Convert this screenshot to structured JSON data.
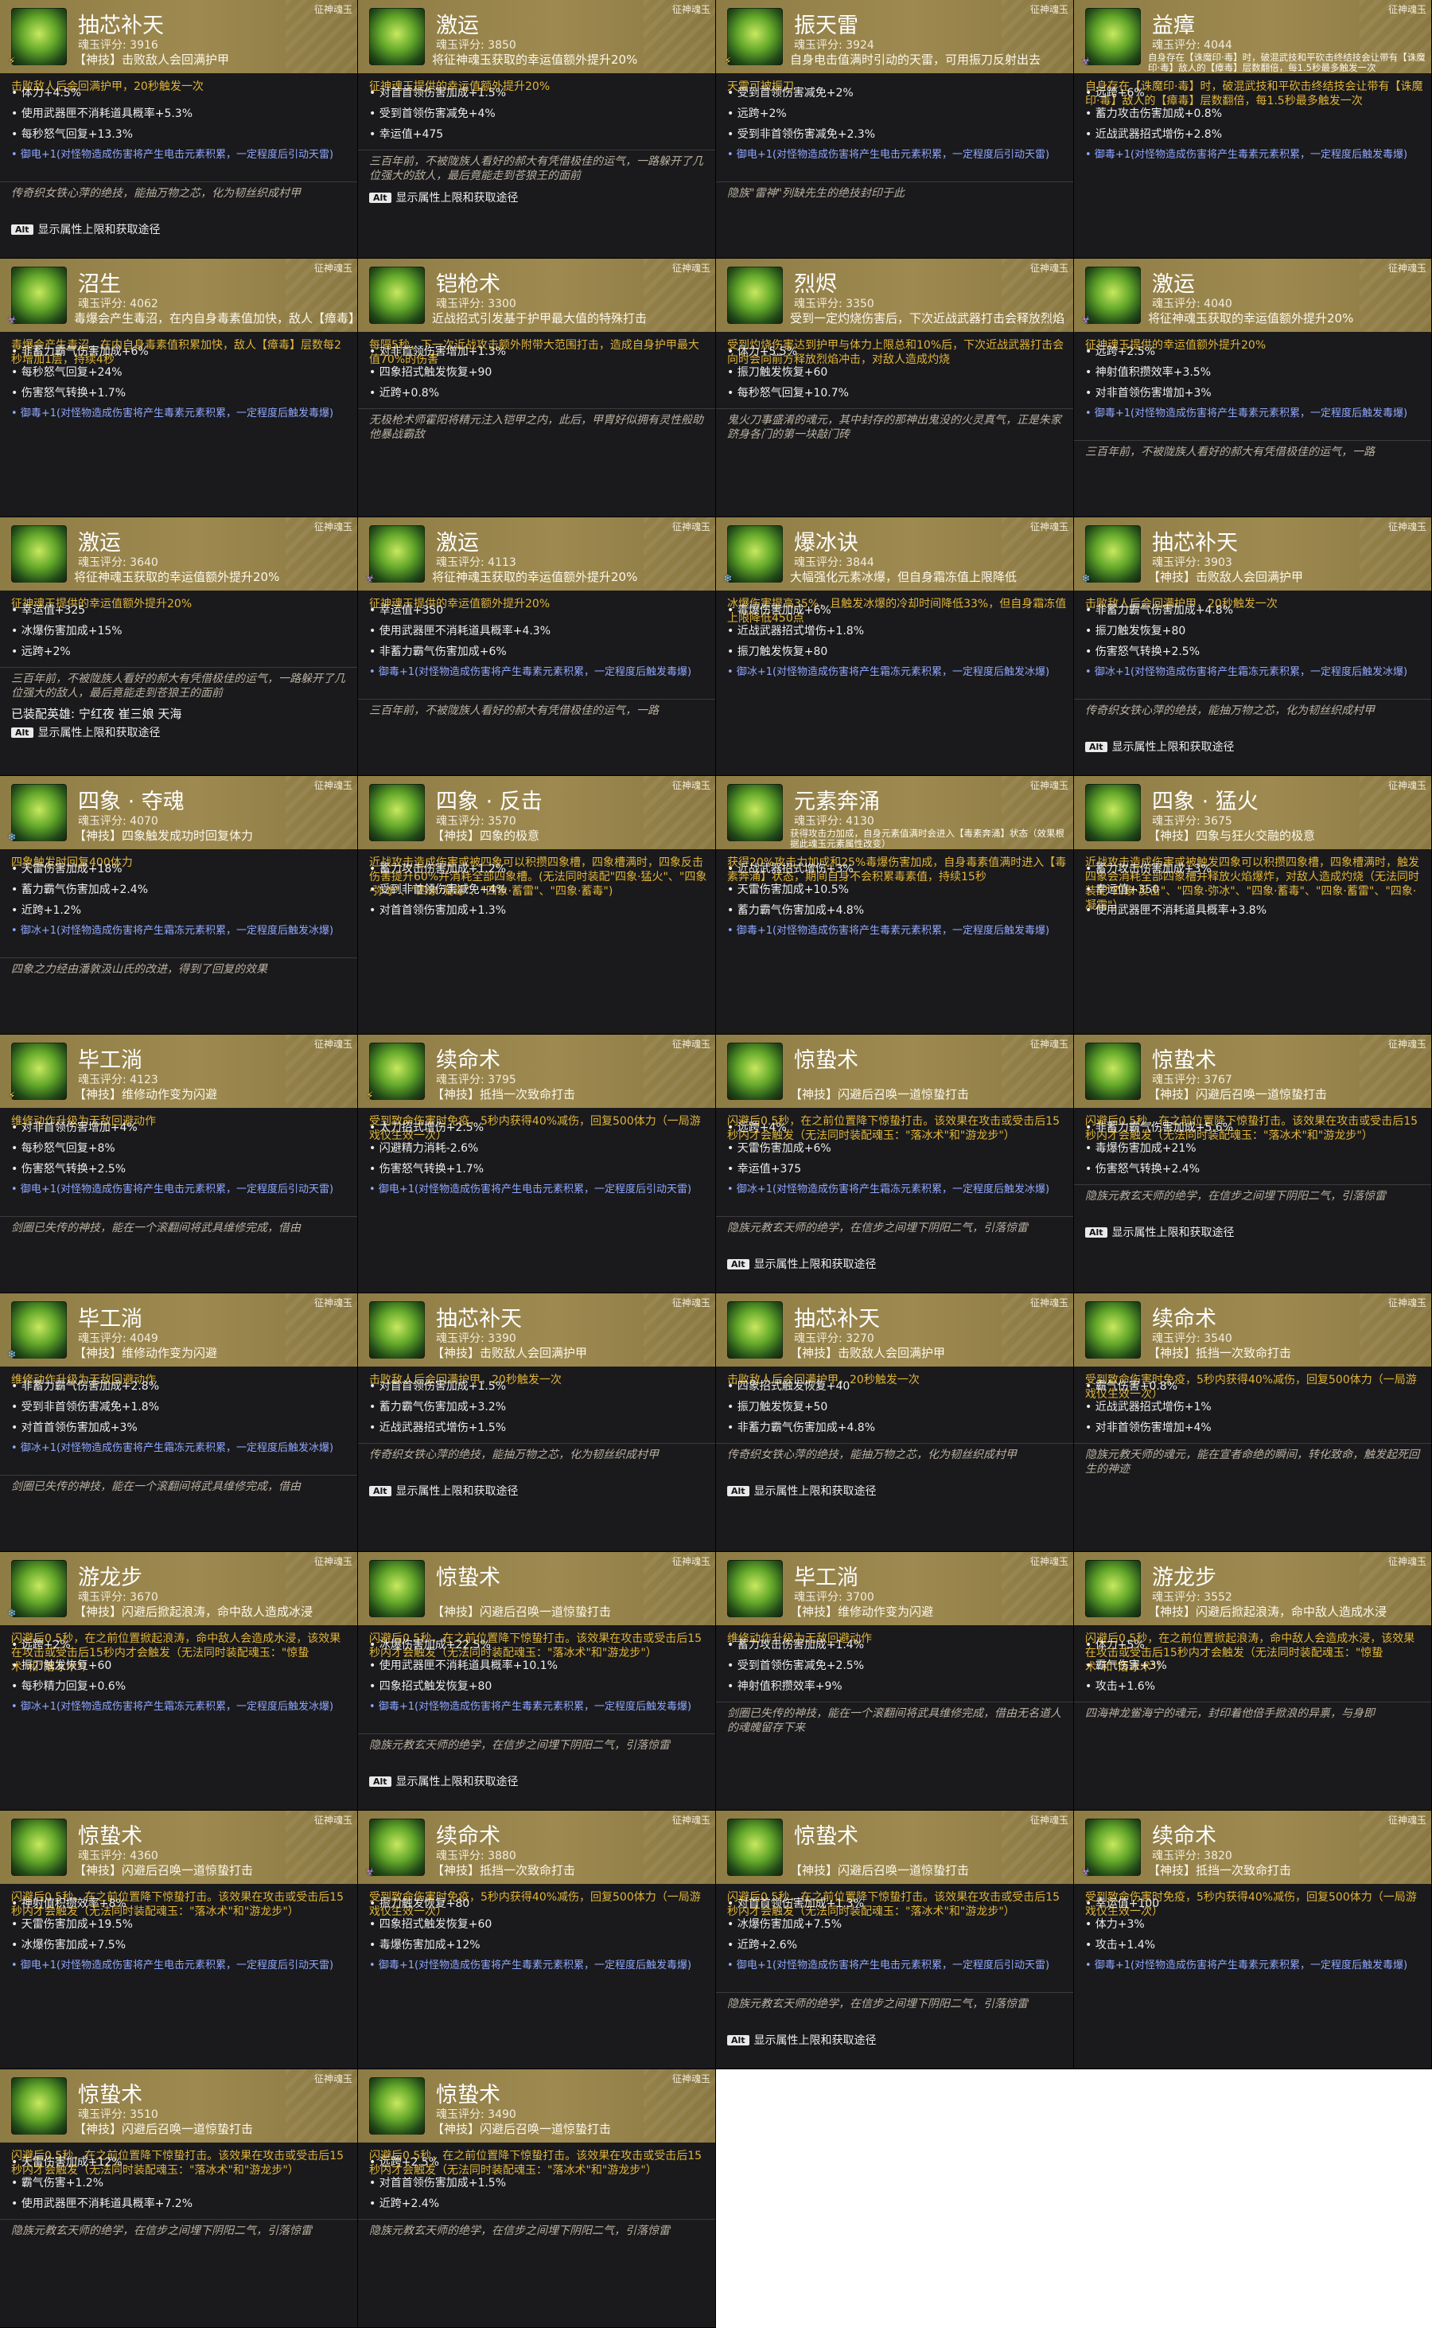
{
  "cards": [
    {
      "type": "征神魂玉",
      "name": "抽芯补天",
      "score": "魂玉评分: 3916",
      "desc": "【神技】击败敌人会回满护甲",
      "element": "thunder",
      "effect": "击败敌人后会回满护甲，20秒触发一次",
      "stats": [
        "体力+4.5%",
        "使用武器匣不消耗道具概率+5.3%",
        "每秒怒气回复+13.3%"
      ],
      "set": "御电+1(对怪物造成伤害将产生电击元素积累，一定程度后引动天雷)",
      "lore": "传奇织女铁心萍的绝技，能抽万物之芯，化为韧丝织成村甲",
      "footer": "显示属性上限和获取途径"
    },
    {
      "type": "征神魂玉",
      "name": "激运",
      "score": "魂玉评分: 3850",
      "desc": "将征神魂玉获取的幸运值额外提升20%",
      "element": "",
      "effect": "征神魂玉提供的幸运值额外提升20%",
      "stats": [
        "对首首领伤害加成+1.5%",
        "受到首领伤害减免+4%",
        "幸运值+475"
      ],
      "set": "",
      "lore": "三百年前，不被陇族人看好的郝大有凭借极佳的运气，一路躲开了几位强大的敌人，最后竟能走到苍狼王的面前",
      "footer": "显示属性上限和获取途径"
    },
    {
      "type": "征神魂玉",
      "name": "振天雷",
      "score": "魂玉评分: 3924",
      "desc": "自身电击值满时引动的天雷，可用振刀反射出去",
      "element": "thunder",
      "effect": "天雷可被振刀",
      "stats": [
        "受到首领伤害减免+2%",
        "远跨+2%",
        "受到非首领伤害减免+2.3%"
      ],
      "set": "御电+1(对怪物造成伤害将产生电击元素积累，一定程度后引动天雷)",
      "lore": "隐族\"雷神\"列缺先生的绝技封印于此",
      "footer": ""
    },
    {
      "type": "征神魂玉",
      "name": "益瘴",
      "score": "魂玉评分: 4044",
      "desc": "自身存在【诛魔印·毒】时，破混武技和平砍击终结技会让带有【诛魔印·毒】敌人的【瘴毒】层数翻倍，每1.5秒最多触发一次",
      "descSmall": true,
      "element": "poison",
      "effect": "自身存在【诛魔印·毒】时，破混武技和平砍击终结技会让带有【诛魔印·毒】敌人的【瘴毒】层数翻倍，每1.5秒最多触发一次",
      "stats": [
        "远跨+6%",
        "蓄力攻击伤害加成+0.8%",
        "近战武器招式增伤+2.8%"
      ],
      "set": "御毒+1(对怪物造成伤害将产生毒素元素积累，一定程度后触发毒爆)",
      "lore": "",
      "footer": ""
    },
    {
      "type": "征神魂玉",
      "name": "沼生",
      "score": "魂玉评分: 4062",
      "desc": "毒爆会产生毒沼，在内自身毒素值加快，敌人【瘴毒】层数",
      "element": "poison",
      "effect": "毒爆会产生毒沼，在内自身毒素值积累加快，敌人【瘴毒】层数每2秒增加1层，持续4秒",
      "stats": [
        "非蓄力霸气伤害加成+6%",
        "每秒怒气回复+24%",
        "伤害怒气转换+1.7%"
      ],
      "set": "御毒+1(对怪物造成伤害将产生毒素元素积累，一定程度后触发毒爆)",
      "lore": "",
      "footer": ""
    },
    {
      "type": "征神魂玉",
      "name": "铠枪术",
      "score": "魂玉评分: 3300",
      "desc": "近战招式引发基于护甲最大值的特殊打击",
      "element": "",
      "effect": "每隔5秒，下一次近战攻击额外附带大范围打击，造成自身护甲最大值70%的伤害",
      "stats": [
        "对非首领伤害增加+1.3%",
        "四象招式触发恢复+90",
        "近跨+0.8%"
      ],
      "set": "",
      "lore": "无极枪术师霍阳将精元注入铠甲之内，此后，甲胄好似拥有灵性般助他暴战霸敌",
      "footer": ""
    },
    {
      "type": "征神魂玉",
      "name": "烈烬",
      "score": "魂玉评分: 3350",
      "desc": "受到一定灼烧伤害后，下次近战武器打击会释放烈焰",
      "element": "",
      "effect": "受到灼烧伤害达到护甲与体力上限总和10%后，下次近战武器打击会向时会向前方释放烈焰冲击，对敌人造成灼烧",
      "stats": [
        "体力+5.5%",
        "振刀触发恢复+60",
        "每秒怒气回复+10.7%"
      ],
      "set": "",
      "lore": "鬼火刀事盛淆的魂元，其中封存的那神出鬼没的火灵真气，正是朱家跻身各门的第一块敲门砖",
      "footer": ""
    },
    {
      "type": "征神魂玉",
      "name": "激运",
      "score": "魂玉评分: 4040",
      "desc": "将征神魂玉获取的幸运值额外提升20%",
      "element": "poison",
      "effect": "征神魂玉提供的幸运值额外提升20%",
      "stats": [
        "远跨+2.5%",
        "神射值积攒效率+3.5%",
        "对非首领伤害增加+3%"
      ],
      "set": "御毒+1(对怪物造成伤害将产生毒素元素积累，一定程度后触发毒爆)",
      "lore": "三百年前，不被陇族人看好的郝大有凭借极佳的运气，一路",
      "footer": ""
    },
    {
      "type": "征神魂玉",
      "name": "激运",
      "score": "魂玉评分: 3640",
      "desc": "将征神魂玉获取的幸运值额外提升20%",
      "element": "",
      "effect": "征神魂玉提供的幸运值额外提升20%",
      "stats": [
        "幸运值+325",
        "冰爆伤害加成+15%",
        "远跨+2%"
      ],
      "set": "",
      "lore": "三百年前，不被陇族人看好的郝大有凭借极佳的运气，一路躲开了几位强大的敌人，最后竟能走到苍狼王的面前",
      "footer": "显示属性上限和获取途径",
      "equip": "已装配英雄: 宁红夜 崔三娘 天海"
    },
    {
      "type": "征神魂玉",
      "name": "激运",
      "score": "魂玉评分: 4113",
      "desc": "将征神魂玉获取的幸运值额外提升20%",
      "element": "poison",
      "effect": "征神魂玉提供的幸运值额外提升20%",
      "stats": [
        "幸运值+350",
        "使用武器匣不消耗道具概率+4.3%",
        "非蓄力霸气伤害加成+6%"
      ],
      "set": "御毒+1(对怪物造成伤害将产生毒素元素积累，一定程度后触发毒爆)",
      "lore": "三百年前，不被陇族人看好的郝大有凭借极佳的运气，一路",
      "footer": ""
    },
    {
      "type": "征神魂玉",
      "name": "爆冰诀",
      "score": "魂玉评分: 3844",
      "desc": "大幅强化元素冰爆，但自身霜冻值上限降低",
      "element": "ice",
      "effect": "冰爆伤害提高35%，且触发冰爆的冷却时间降低33%，但自身霜冻值上限降低450点",
      "stats": [
        "毒爆伤害加成+6%",
        "近战武器招式增伤+1.8%",
        "振刀触发恢复+80"
      ],
      "set": "御冰+1(对怪物造成伤害将产生霜冻元素积累，一定程度后触发冰爆)",
      "lore": "",
      "footer": ""
    },
    {
      "type": "征神魂玉",
      "name": "抽芯补天",
      "score": "魂玉评分: 3903",
      "desc": "【神技】击败敌人会回满护甲",
      "element": "ice",
      "effect": "击败敌人后会回满护甲，20秒触发一次",
      "stats": [
        "非蓄力霸气伤害加成+4.8%",
        "振刀触发恢复+80",
        "伤害怒气转换+2.5%"
      ],
      "set": "御冰+1(对怪物造成伤害将产生霜冻元素积累，一定程度后触发冰爆)",
      "lore": "传奇织女铁心萍的绝技，能抽万物之芯，化为韧丝织成村甲",
      "footer": "显示属性上限和获取途径"
    },
    {
      "type": "征神魂玉",
      "name": "四象 · 夺魂",
      "score": "魂玉评分: 4070",
      "desc": "【神技】四象触发成功时回复体力",
      "element": "ice",
      "effect": "四象触发时回复400体力",
      "stats": [
        "天雷伤害加成+18%",
        "蓄力霸气伤害加成+2.4%",
        "近跨+1.2%"
      ],
      "set": "御冰+1(对怪物造成伤害将产生霜冻元素积累，一定程度后触发冰爆)",
      "lore": "四象之力经由潘敦汲山氏的改进，得到了回复的效果",
      "footer": ""
    },
    {
      "type": "征神魂玉",
      "name": "四象 · 反击",
      "score": "魂玉评分: 3570",
      "desc": "【神技】四象的极意",
      "element": "",
      "effect": "近战攻击造成伤害或被四象可以积攒四象槽，四象槽满时，四象反击伤害提升60%并消耗全部四象槽。(无法同时装配\"四象·猛火\"、\"四象·弥冰\"、\"四象·凝毒\"、\"四象·蓄雷\"、\"四象·蓄毒\")",
      "stats": [
        "蓄力攻击伤害加成+1.2%",
        "受到非首领伤害减免+4%",
        "对首首领伤害加成+1.3%"
      ],
      "set": "",
      "lore": "",
      "footer": ""
    },
    {
      "type": "征神魂玉",
      "name": "元素奔涌",
      "score": "魂玉评分: 4130",
      "desc": "获得攻击力加成，自身元素值满时会进入【毒素奔涌】状态（效果根据此魂玉元素属性改变）",
      "descSmall": true,
      "element": "",
      "effect": "获得20%攻击力加成和25%毒爆伤害加成，自身毒素值满时进入【毒素奔涌】状态，期间自身不会积累毒素值，持续15秒",
      "stats": [
        "近战武器招式增伤+3%",
        "天雷伤害加成+10.5%",
        "蓄力霸气伤害加成+4.8%"
      ],
      "set": "御毒+1(对怪物造成伤害将产生毒素元素积累，一定程度后触发毒爆)",
      "lore": "",
      "footer": ""
    },
    {
      "type": "征神魂玉",
      "name": "四象 · 猛火",
      "score": "魂玉评分: 3675",
      "desc": "【神技】四象与狂火交融的极意",
      "element": "",
      "effect": "近战攻击造成伤害或被触发四象可以积攒四象槽，四象槽满时，触发四象会消耗全部四象槽并释放火焰爆炸，对敌人造成灼烧（无法同时装配\"四象·反击\"、\"四象·弥冰\"、\"四象·蓄毒\"、\"四象·蓄雷\"、\"四象·凝霜\"）",
      "stats": [
        "蓄力攻击伤害加成+3%",
        "幸运值+350",
        "使用武器匣不消耗道具概率+3.8%"
      ],
      "set": "",
      "lore": "",
      "footer": ""
    },
    {
      "type": "征神魂玉",
      "name": "毕工淌",
      "score": "魂玉评分: 4123",
      "desc": "【神技】维修动作变为闪避",
      "element": "thunder",
      "effect": "维修动作升级为无敌回避动作",
      "stats": [
        "对非首领伤害增加+4%",
        "每秒怒气回复+8%",
        "伤害怒气转换+2.5%"
      ],
      "set": "御电+1(对怪物造成伤害将产生电击元素积累，一定程度后引动天雷)",
      "lore": "剑圈已失传的神技，能在一个滚翻间将武具维修完成，借由",
      "footer": ""
    },
    {
      "type": "征神魂玉",
      "name": "续命术",
      "score": "魂玉评分: 3795",
      "desc": "【神技】抵挡一次致命打击",
      "element": "thunder",
      "effect": "受到致命伤害时免疫，5秒内获得40%减伤，回复500体力（一局游戏仅生效一次）",
      "stats": [
        "太刀招式增伤+2.5%",
        "闪避精力消耗-2.6%",
        "伤害怒气转换+1.7%"
      ],
      "set": "御电+1(对怪物造成伤害将产生电击元素积累，一定程度后引动天雷)",
      "lore": "",
      "footer": ""
    },
    {
      "type": "征神魂玉",
      "name": "惊蛰术",
      "score": "",
      "desc": "【神技】闪避后召唤一道惊蛰打击",
      "partial": true,
      "element": "",
      "effect": "闪避后0.5秒，在之前位置降下惊蛰打击。该效果在攻击或受击后15秒内才会触发（无法同时装配魂玉：\"落冰术\"和\"游龙步\"）",
      "stats": [
        "远跨+4%",
        "天雷伤害加成+6%",
        "幸运值+375"
      ],
      "set": "御冰+1(对怪物造成伤害将产生霜冻元素积累，一定程度后触发冰爆)",
      "lore": "隐族元教玄天师的绝学，在信步之间埋下阴阳二气，引落惊雷",
      "footer": "显示属性上限和获取途径"
    },
    {
      "type": "征神魂玉",
      "name": "惊蛰术",
      "score": "魂玉评分: 3767",
      "desc": "【神技】闪避后召唤一道惊蛰打击",
      "element": "",
      "effect": "闪避后0.5秒，在之前位置降下惊蛰打击。该效果在攻击或受击后15秒内才会触发（无法同时装配魂玉：\"落冰术\"和\"游龙步\"）",
      "stats": [
        "非蓄力霸气伤害加成+5.6%",
        "毒爆伤害加成+21%",
        "伤害怒气转换+2.4%"
      ],
      "set": "",
      "lore": "隐族元教玄天师的绝学，在信步之间埋下阴阳二气，引落惊雷",
      "footer": "显示属性上限和获取途径"
    },
    {
      "type": "征神魂玉",
      "name": "毕工淌",
      "score": "魂玉评分: 4049",
      "desc": "【神技】维修动作变为闪避",
      "element": "ice",
      "effect": "维修动作升级为无敌回避动作",
      "stats": [
        "非蓄力霸气伤害加成+2.8%",
        "受到非首领伤害减免+1.8%",
        "对首首领伤害加成+3%"
      ],
      "set": "御冰+1(对怪物造成伤害将产生霜冻元素积累，一定程度后触发冰爆)",
      "lore": "剑圈已失传的神技，能在一个滚翻间将武具维修完成，借由",
      "footer": ""
    },
    {
      "type": "征神魂玉",
      "name": "抽芯补天",
      "score": "魂玉评分: 3390",
      "desc": "【神技】击败敌人会回满护甲",
      "element": "",
      "effect": "击败敌人后会回满护甲，20秒触发一次",
      "stats": [
        "对首首领伤害加成+1.5%",
        "蓄力霸气伤害加成+3.2%",
        "近战武器招式增伤+1.5%"
      ],
      "set": "",
      "lore": "传奇织女铁心萍的绝技，能抽万物之芯，化为韧丝织成村甲",
      "footer": "显示属性上限和获取途径"
    },
    {
      "type": "征神魂玉",
      "name": "抽芯补天",
      "score": "魂玉评分: 3270",
      "desc": "【神技】击败敌人会回满护甲",
      "element": "",
      "effect": "击败敌人后会回满护甲，20秒触发一次",
      "stats": [
        "四象招式触发恢复+40",
        "振刀触发恢复+50",
        "非蓄力霸气伤害加成+4.8%"
      ],
      "set": "",
      "lore": "传奇织女铁心萍的绝技，能抽万物之芯，化为韧丝织成村甲",
      "footer": "显示属性上限和获取途径"
    },
    {
      "type": "征神魂玉",
      "name": "续命术",
      "score": "魂玉评分: 3540",
      "desc": "【神技】抵挡一次致命打击",
      "element": "",
      "effect": "受到致命伤害时免疫，5秒内获得40%减伤，回复500体力（一局游戏仅生效一次）",
      "stats": [
        "霸气伤害+0.8%",
        "近战武器招式增伤+1%",
        "对非首领伤害增加+4%"
      ],
      "set": "",
      "lore": "隐族元教天师的魂元，能在宣者命绝的瞬间，转化致命，触发起死回生的神迹",
      "footer": ""
    },
    {
      "type": "征神魂玉",
      "name": "游龙步",
      "score": "魂玉评分: 3670",
      "desc": "【神技】闪避后掀起浪涛，命中敌人造成冰浸",
      "element": "ice",
      "effect": "闪避后0.5秒，在之前位置掀起浪涛，命中敌人会造成水浸，该效果在攻击或受击后15秒内才会触发（无法同时装配魂玉：\"惊蛰术\"和\"落冰术\"）",
      "stats": [
        "远跨+2%",
        "振刀触发恢复+60",
        "每秒精力回复+0.6%"
      ],
      "set": "御冰+1(对怪物造成伤害将产生霜冻元素积累，一定程度后触发冰爆)",
      "lore": "",
      "footer": ""
    },
    {
      "type": "征神魂玉",
      "name": "惊蛰术",
      "score": "",
      "desc": "【神技】闪避后召唤一道惊蛰打击",
      "partial": true,
      "element": "",
      "effect": "闪避后0.5秒，在之前位置降下惊蛰打击。该效果在攻击或受击后15秒内才会触发（无法同时装配魂玉：\"落冰术\"和\"游龙步\"）",
      "stats": [
        "冰爆伤害加成+22.5%",
        "使用武器匣不消耗道具概率+10.1%",
        "四象招式触发恢复+80"
      ],
      "set": "御毒+1(对怪物造成伤害将产生毒素元素积累，一定程度后触发毒爆)",
      "lore": "隐族元教玄天师的绝学，在信步之间埋下阴阳二气，引落惊雷",
      "footer": "显示属性上限和获取途径"
    },
    {
      "type": "征神魂玉",
      "name": "毕工淌",
      "score": "魂玉评分: 3700",
      "desc": "【神技】维修动作变为闪避",
      "element": "",
      "effect": "维修动作升级为无敌回避动作",
      "stats": [
        "蓄力攻击伤害加成+1.4%",
        "受到首领伤害减免+2.5%",
        "神射值积攒效率+9%"
      ],
      "set": "",
      "lore": "剑圈已失传的神技，能在一个滚翻间将武具维修完成，借由无名道人的魂魄留存下来",
      "footer": ""
    },
    {
      "type": "征神魂玉",
      "name": "游龙步",
      "score": "魂玉评分: 3552",
      "desc": "【神技】闪避后掀起浪涛，命中敌人造成水浸",
      "element": "",
      "effect": "闪避后0.5秒，在之前位置掀起浪涛，命中敌人会造成水浸，该效果在攻击或受击后15秒内才会触发（无法同时装配魂玉：\"惊蛰术\"和\"落冰术\"）",
      "stats": [
        "体力+5%",
        "霸气伤害+3%",
        "攻击+1.6%"
      ],
      "set": "",
      "lore": "四海神龙鲎海宁的魂元，封印着他倍手掀浪的异禀，与身即",
      "footer": ""
    },
    {
      "type": "征神魂玉",
      "name": "惊蛰术",
      "score": "魂玉评分: 4360",
      "desc": "【神技】闪避后召唤一道惊蛰打击",
      "element": "",
      "effect": "闪避后0.5秒，在之前位置降下惊蛰打击。该效果在攻击或受击后15秒内才会触发（无法同时装配魂玉：\"落冰术\"和\"游龙步\"）",
      "stats": [
        "神射值积攒效率+8%",
        "天雷伤害加成+19.5%",
        "冰爆伤害加成+7.5%"
      ],
      "set": "御电+1(对怪物造成伤害将产生电击元素积累，一定程度后引动天雷)",
      "lore": "",
      "footer": ""
    },
    {
      "type": "征神魂玉",
      "name": "续命术",
      "score": "魂玉评分: 3880",
      "desc": "【神技】抵挡一次致命打击",
      "element": "poison",
      "effect": "受到致命伤害时免疫，5秒内获得40%减伤，回复500体力（一局游戏仅生效一次）",
      "stats": [
        "振刀触发恢复+80",
        "四象招式触发恢复+60",
        "毒爆伤害加成+12%"
      ],
      "set": "御毒+1(对怪物造成伤害将产生毒素元素积累，一定程度后触发毒爆)",
      "lore": "",
      "footer": ""
    },
    {
      "type": "征神魂玉",
      "name": "惊蛰术",
      "score": "",
      "desc": "【神技】闪避后召唤一道惊蛰打击",
      "partial": true,
      "element": "",
      "effect": "闪避后0.5秒，在之前位置降下惊蛰打击。该效果在攻击或受击后15秒内才会触发（无法同时装配魂玉：\"落冰术\"和\"游龙步\"）",
      "stats": [
        "对首首领伤害加成+1.3%",
        "冰爆伤害加成+7.5%",
        "近跨+2.6%"
      ],
      "set": "御电+1(对怪物造成伤害将产生电击元素积累，一定程度后引动天雷)",
      "lore": "隐族元教玄天师的绝学，在信步之间埋下阴阳二气，引落惊雷",
      "footer": "显示属性上限和获取途径"
    },
    {
      "type": "征神魂玉",
      "name": "续命术",
      "score": "魂玉评分: 3820",
      "desc": "【神技】抵挡一次致命打击",
      "element": "poison",
      "effect": "受到致命伤害时免疫，5秒内获得40%减伤，回复500体力（一局游戏仅生效一次）",
      "stats": [
        "幸运值+100",
        "体力+3%",
        "攻击+1.4%"
      ],
      "set": "御毒+1(对怪物造成伤害将产生毒素元素积累，一定程度后触发毒爆)",
      "lore": "",
      "footer": ""
    },
    {
      "type": "征神魂玉",
      "name": "惊蛰术",
      "score": "魂玉评分: 3510",
      "desc": "【神技】闪避后召唤一道惊蛰打击",
      "element": "",
      "effect": "闪避后0.5秒，在之前位置降下惊蛰打击。该效果在攻击或受击后15秒内才会触发（无法同时装配魂玉：\"落冰术\"和\"游龙步\"）",
      "stats": [
        "天雷伤害加成+12%",
        "霸气伤害+1.2%",
        "使用武器匣不消耗道具概率+7.2%"
      ],
      "set": "",
      "lore": "隐族元教玄天师的绝学，在信步之间埋下阴阳二气，引落惊雷",
      "footer": ""
    },
    {
      "type": "征神魂玉",
      "name": "惊蛰术",
      "score": "魂玉评分: 3490",
      "desc": "【神技】闪避后召唤一道惊蛰打击",
      "element": "",
      "effect": "闪避后0.5秒，在之前位置降下惊蛰打击。该效果在攻击或受击后15秒内才会触发（无法同时装配魂玉：\"落冰术\"和\"游龙步\"）",
      "stats": [
        "远跨+2.5%",
        "对首首领伤害加成+1.5%",
        "近跨+2.4%"
      ],
      "set": "",
      "lore": "隐族元教玄天师的绝学，在信步之间埋下阴阳二气，引落惊雷",
      "footer": ""
    }
  ],
  "alt_key": "Alt",
  "element_glyphs": {
    "thunder": "⚡",
    "ice": "❄",
    "poison": "☣"
  }
}
